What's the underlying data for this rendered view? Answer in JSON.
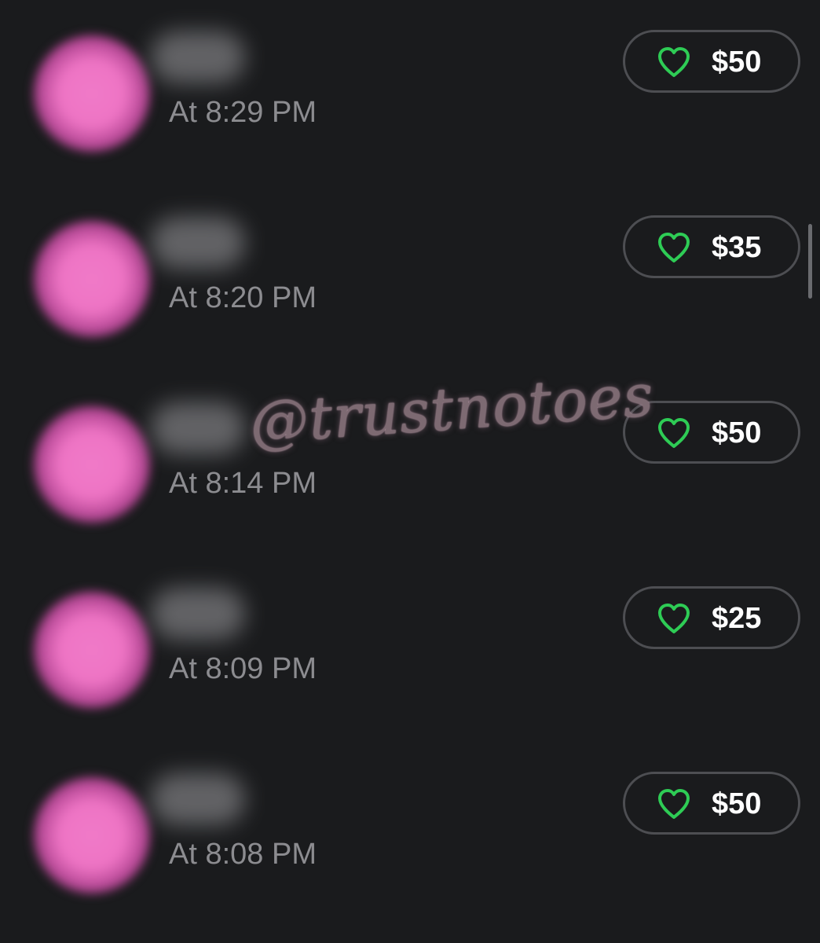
{
  "colors": {
    "background": "#1a1b1d",
    "avatar_pink": "#ee74c4",
    "heart_green": "#2ecc55",
    "pill_border": "#4d4e52",
    "time_text": "#8c8c90"
  },
  "tips": [
    {
      "time": "At 8:29 PM",
      "amount": "$50",
      "icon": "heart-outline-icon"
    },
    {
      "time": "At 8:20 PM",
      "amount": "$35",
      "icon": "heart-outline-icon"
    },
    {
      "time": "At 8:14 PM",
      "amount": "$50",
      "icon": "heart-outline-icon"
    },
    {
      "time": "At 8:09 PM",
      "amount": "$25",
      "icon": "heart-outline-icon"
    },
    {
      "time": "At 8:08 PM",
      "amount": "$50",
      "icon": "heart-outline-icon"
    }
  ],
  "watermark": "@trustnotoes"
}
